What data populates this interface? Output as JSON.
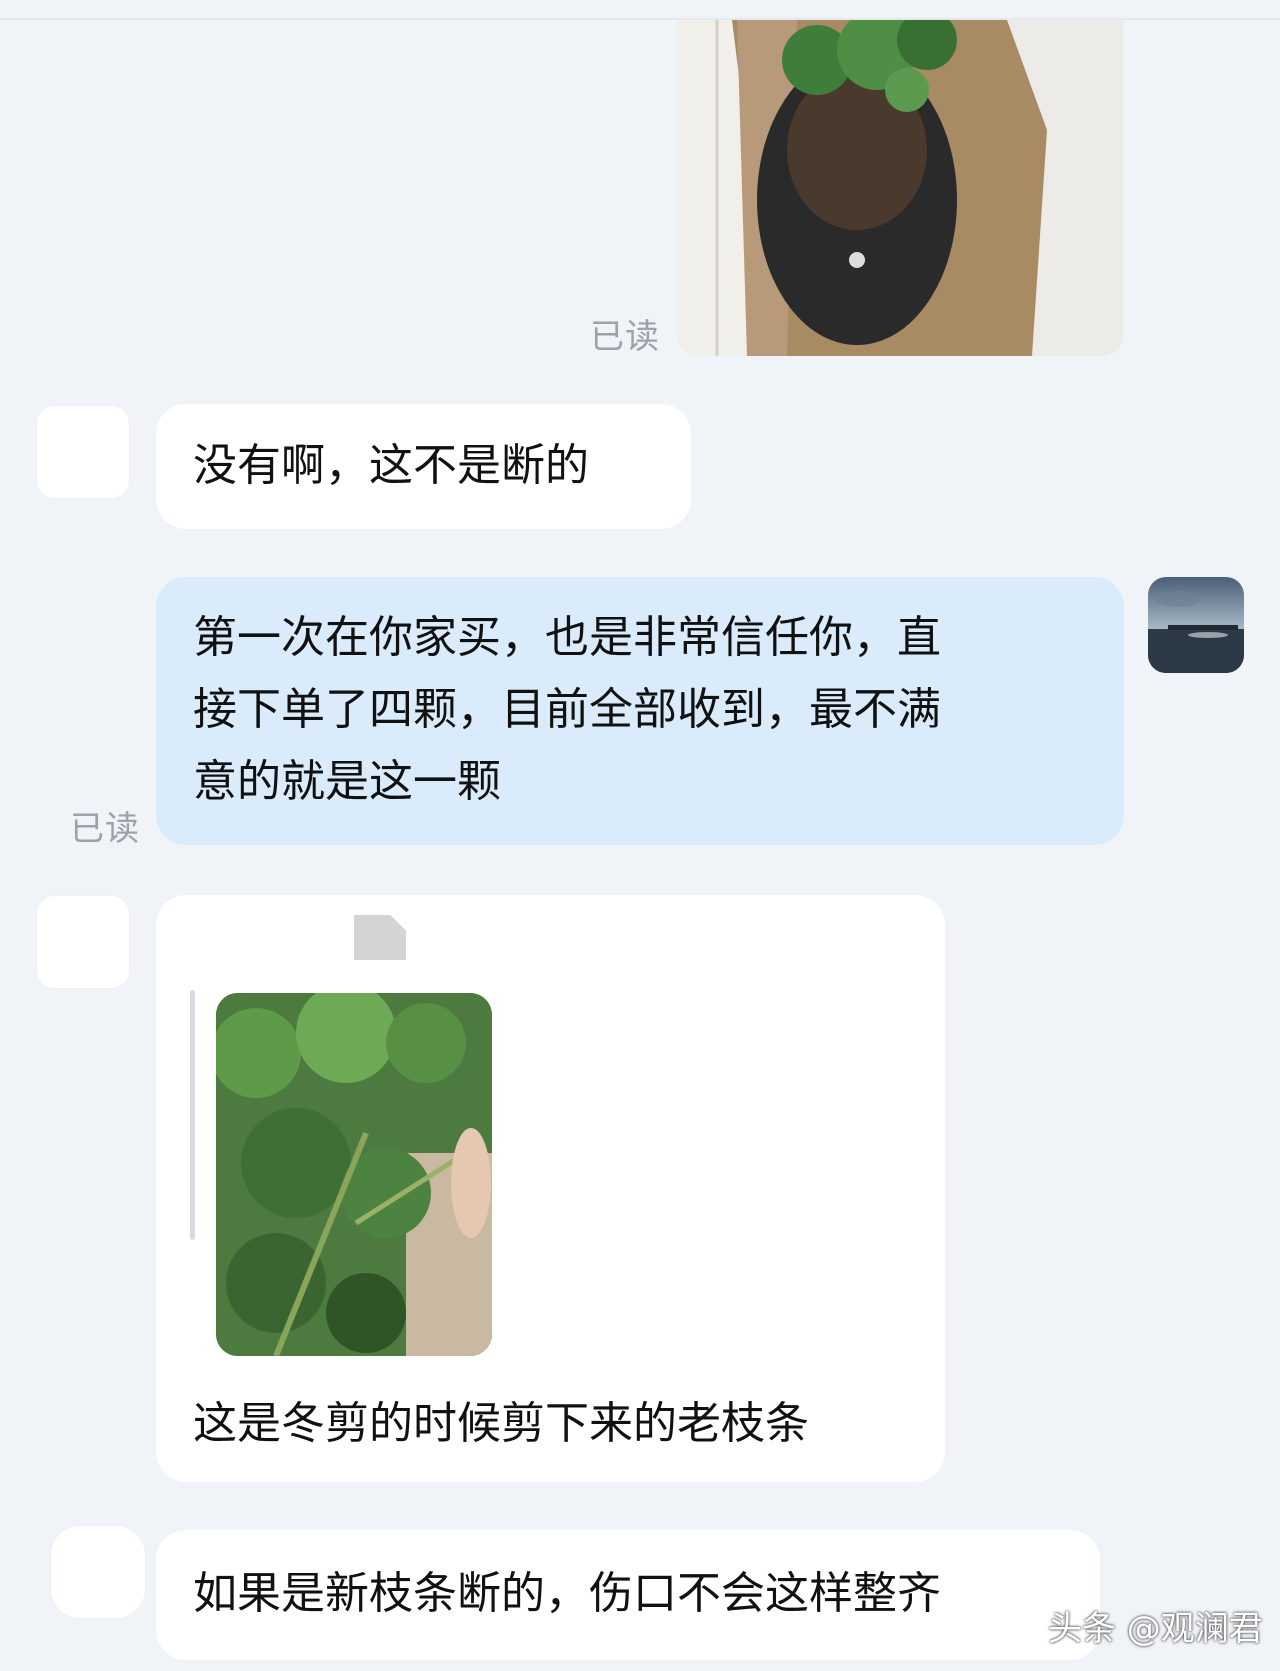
{
  "messages": {
    "m1": {
      "read_label": "已读"
    },
    "m2": {
      "text": "没有啊，这不是断的"
    },
    "m3": {
      "lines": [
        "第一次在你家买，也是非常信任你，直",
        "接下单了四颗，目前全部收到，最不满",
        "意的就是这一颗"
      ],
      "read_label": "已读"
    },
    "m4": {
      "text": "这是冬剪的时候剪下来的老枝条"
    },
    "m5": {
      "text": "如果是新枝条断的，伤口不会这样整齐"
    }
  },
  "watermark": "头条 @观澜君",
  "colors": {
    "background": "#f0f3f8",
    "incoming_bubble": "#ffffff",
    "outgoing_bubble": "#daecfb",
    "read_receipt": "#9ea2a8"
  }
}
